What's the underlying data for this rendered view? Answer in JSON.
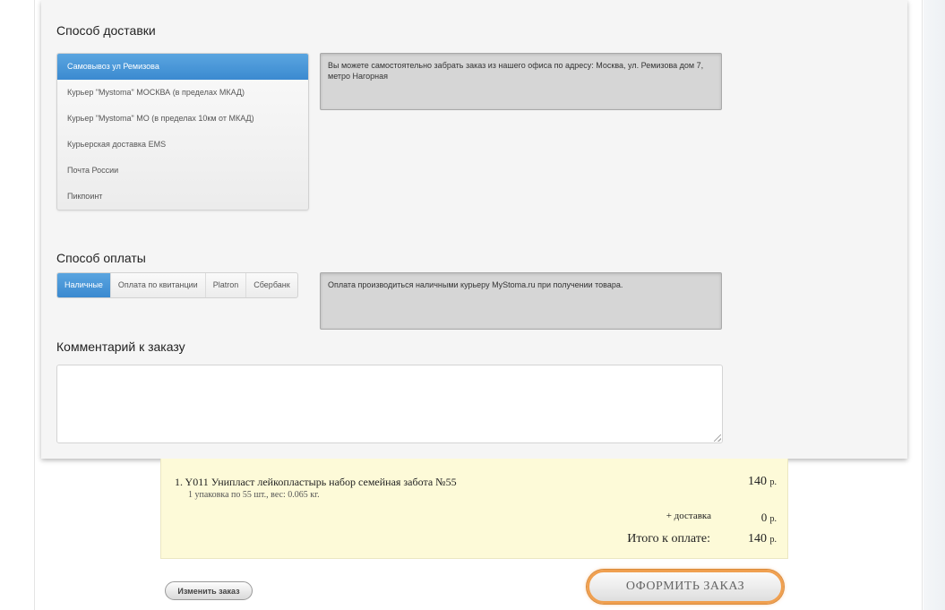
{
  "delivery": {
    "title": "Способ доставки",
    "options": [
      "Самовывоз ул Ремизова",
      "Курьер \"Mystoma\" МОСКВА (в пределах МКАД)",
      "Курьер \"Mystoma\" МО (в пределах 10км от МКАД)",
      "Курьерская доставка EMS",
      "Почта России",
      "Пикпоинт"
    ],
    "selected_index": 0,
    "info": "Вы можете самостоятельно забрать заказ из нашего офиса по адресу: Москва, ул. Ремизова дом 7, метро Нагорная"
  },
  "payment": {
    "title": "Способ оплаты",
    "tabs": [
      "Наличные",
      "Оплата по квитанции",
      "Platron",
      "Сбербанк"
    ],
    "selected_index": 0,
    "info": "Оплата производиться наличными курьеру MyStoma.ru при получении товара."
  },
  "comment": {
    "title": "Комментарий к заказу",
    "value": ""
  },
  "order": {
    "item_line": "1. Y011 Унипласт лейкопластырь набор семейная забота №55",
    "item_sub": "1 упаковка по 55 шт., вес: 0.065 кг.",
    "item_price": "140",
    "currency": "р.",
    "shipping_label": "+ доставка",
    "shipping_price": "0",
    "total_label": "Итого к оплате:",
    "total_price": "140"
  },
  "buttons": {
    "edit_order": "Изменить заказ",
    "submit_order": "ОФОРМИТЬ ЗАКАЗ"
  },
  "colors": {
    "accent": "#3b8ad0",
    "summary_bg": "#fdfad8",
    "submit_border": "#f0a050"
  }
}
